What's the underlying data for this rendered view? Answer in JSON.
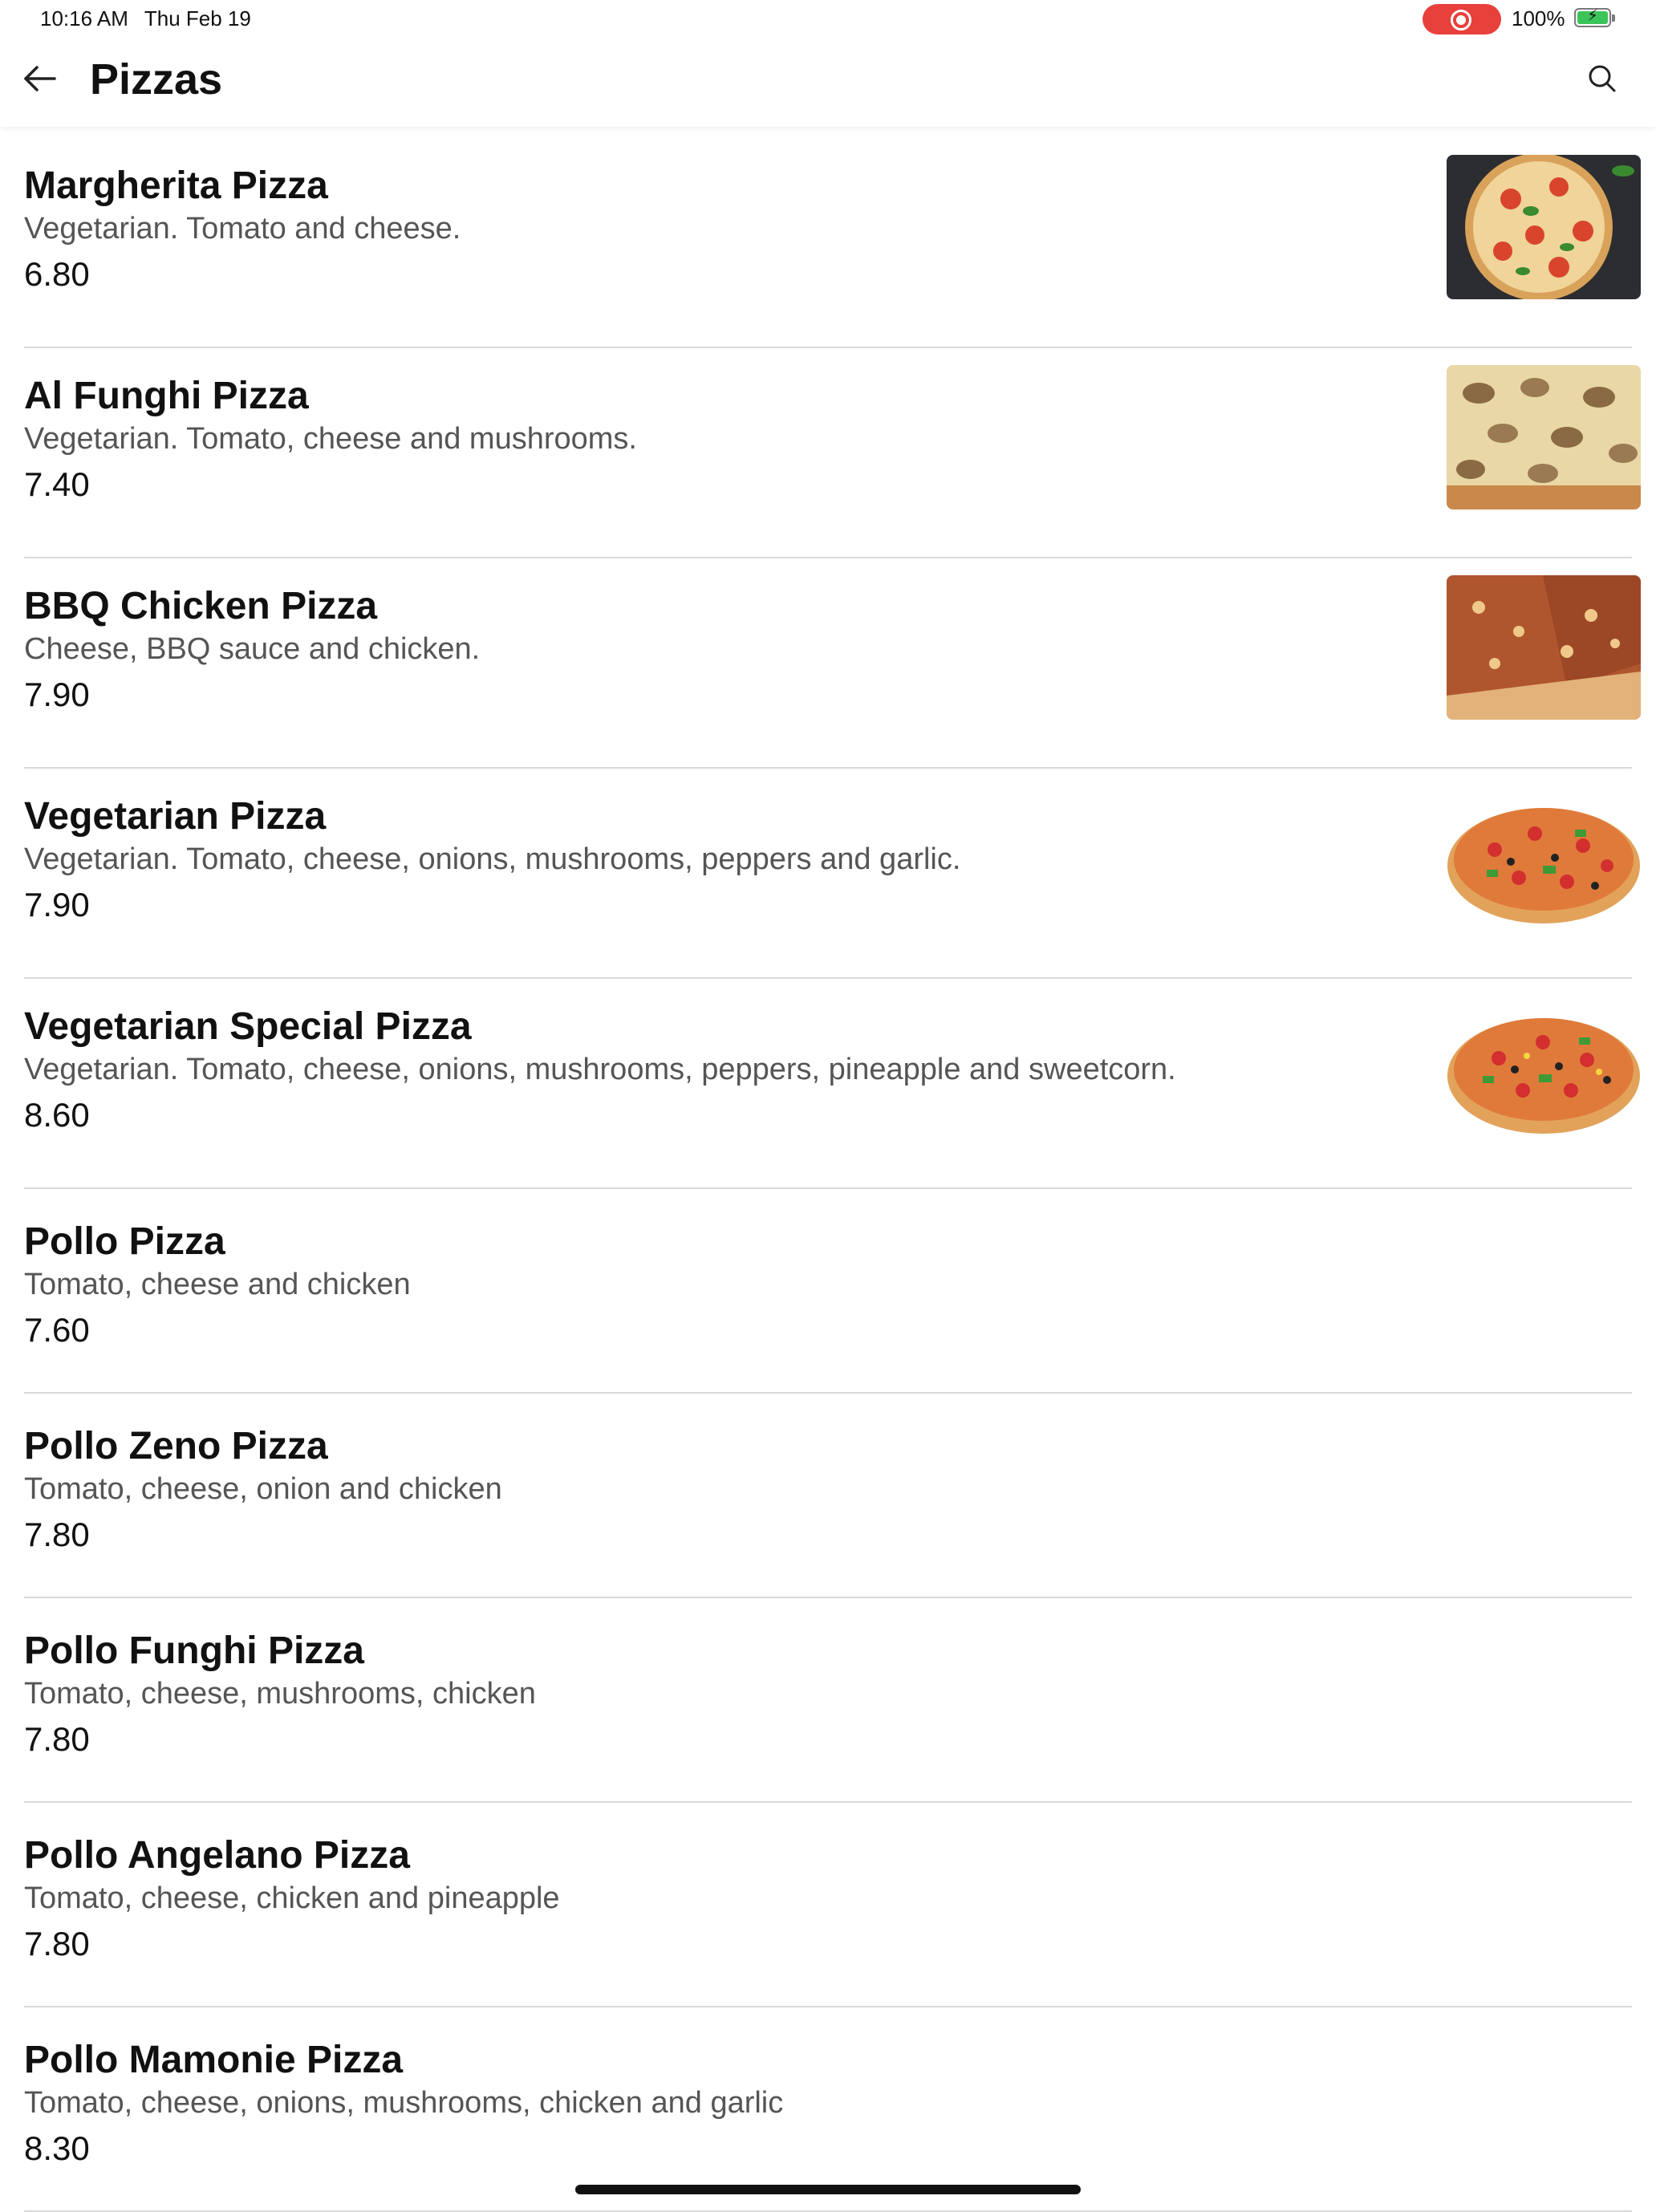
{
  "status_bar": {
    "time": "10:16 AM",
    "date": "Thu Feb 19",
    "battery_percent": "100%",
    "recording_color": "#e8413b",
    "battery_color": "#3bc45a"
  },
  "nav": {
    "title": "Pizzas",
    "back_icon": "arrow-left-icon",
    "search_icon": "search-icon"
  },
  "menu": {
    "items": [
      {
        "name": "Margherita Pizza",
        "description": "Vegetarian. Tomato and cheese.",
        "price": "6.80",
        "image": "margherita-photo"
      },
      {
        "name": "Al Funghi Pizza",
        "description": "Vegetarian. Tomato, cheese and mushrooms.",
        "price": "7.40",
        "image": "funghi-photo"
      },
      {
        "name": "BBQ Chicken Pizza",
        "description": "Cheese, BBQ sauce and chicken.",
        "price": "7.90",
        "image": "bbq-chicken-photo"
      },
      {
        "name": "Vegetarian Pizza",
        "description": "Vegetarian. Tomato, cheese, onions, mushrooms, peppers and garlic.",
        "price": "7.90",
        "image": "vegetarian-photo"
      },
      {
        "name": "Vegetarian Special Pizza",
        "description": "Vegetarian. Tomato, cheese, onions, mushrooms, peppers, pineapple and sweetcorn.",
        "price": "8.60",
        "image": "vegetarian-special-photo"
      },
      {
        "name": "Pollo Pizza",
        "description": "Tomato, cheese and chicken",
        "price": "7.60"
      },
      {
        "name": "Pollo Zeno Pizza",
        "description": "Tomato, cheese, onion and chicken",
        "price": "7.80"
      },
      {
        "name": "Pollo Funghi Pizza",
        "description": "Tomato, cheese, mushrooms, chicken",
        "price": "7.80"
      },
      {
        "name": "Pollo Angelano Pizza",
        "description": "Tomato, cheese, chicken and pineapple",
        "price": "7.80"
      },
      {
        "name": "Pollo Mamonie Pizza",
        "description": "Tomato, cheese, onions, mushrooms, chicken and garlic",
        "price": "8.30"
      }
    ]
  }
}
